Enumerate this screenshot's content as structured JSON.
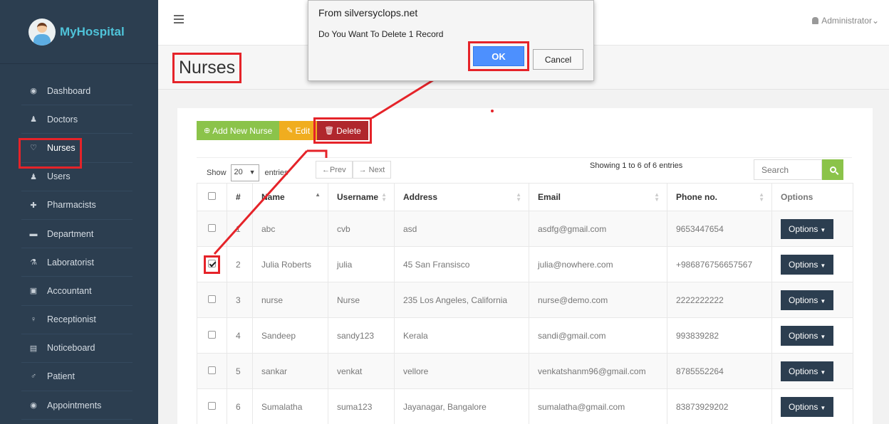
{
  "brand": {
    "name": "MyHospital"
  },
  "sidebar": {
    "items": [
      {
        "label": "Dashboard",
        "icon": "dashboard-icon",
        "glyph": "◉"
      },
      {
        "label": "Doctors",
        "icon": "user-md-icon",
        "glyph": "♟"
      },
      {
        "label": "Nurses",
        "icon": "stethoscope-icon",
        "glyph": "♡"
      },
      {
        "label": "Users",
        "icon": "user-icon",
        "glyph": "♟"
      },
      {
        "label": "Pharmacists",
        "icon": "plus-square-icon",
        "glyph": "✚"
      },
      {
        "label": "Department",
        "icon": "briefcase-icon",
        "glyph": "▬"
      },
      {
        "label": "Laboratorist",
        "icon": "flask-icon",
        "glyph": "⚗"
      },
      {
        "label": "Accountant",
        "icon": "money-icon",
        "glyph": "▣"
      },
      {
        "label": "Receptionist",
        "icon": "female-icon",
        "glyph": "♀"
      },
      {
        "label": "Noticeboard",
        "icon": "file-icon",
        "glyph": "▤"
      },
      {
        "label": "Patient",
        "icon": "male-icon",
        "glyph": "♂"
      },
      {
        "label": "Appointments",
        "icon": "dashboard-icon",
        "glyph": "◉"
      }
    ]
  },
  "header": {
    "user": "Administrator",
    "caret": "⌄"
  },
  "page": {
    "title": "Nurses"
  },
  "toolbar": {
    "add_label": "Add New Nurse",
    "edit_label": "Edit",
    "delete_label": "Delete"
  },
  "controls": {
    "show_label": "Show",
    "entries_value": "20",
    "entries_label": "entries",
    "prev_label": "←Prev",
    "next_label": "→ Next",
    "showing_text": "Showing 1 to 6 of 6 entries",
    "search_placeholder": "Search"
  },
  "table": {
    "headers": [
      "#",
      "Name",
      "Username",
      "Address",
      "Email",
      "Phone no.",
      "Options"
    ],
    "rows": [
      {
        "num": "1",
        "name": "abc",
        "username": "cvb",
        "address": "asd",
        "email": "asdfg@gmail.com",
        "phone": "9653447654",
        "checked": false
      },
      {
        "num": "2",
        "name": "Julia Roberts",
        "username": "julia",
        "address": "45 San Fransisco",
        "email": "julia@nowhere.com",
        "phone": "+986876756657567",
        "checked": true
      },
      {
        "num": "3",
        "name": "nurse",
        "username": "Nurse",
        "address": "235 Los Angeles, California",
        "email": "nurse@demo.com",
        "phone": "2222222222",
        "checked": false
      },
      {
        "num": "4",
        "name": "Sandeep",
        "username": "sandy123",
        "address": "Kerala",
        "email": "sandi@gmail.com",
        "phone": "993839282",
        "checked": false
      },
      {
        "num": "5",
        "name": "sankar",
        "username": "venkat",
        "address": "vellore",
        "email": "venkatshanm96@gmail.com",
        "phone": "8785552264",
        "checked": false
      },
      {
        "num": "6",
        "name": "Sumalatha",
        "username": "suma123",
        "address": "Jayanagar, Bangalore",
        "email": "sumalatha@gmail.com",
        "phone": "83873929202",
        "checked": false
      }
    ],
    "options_label": "Options"
  },
  "dialog": {
    "title": "From silversyclops.net",
    "message": "Do You Want To Delete 1 Record",
    "ok_label": "OK",
    "cancel_label": "Cancel"
  },
  "colors": {
    "sidebar_bg": "#2c3e50",
    "accent_green": "#8bc34a",
    "edit_yellow": "#f0ad1f",
    "delete_red": "#b0272d",
    "annotation_red": "#e52329",
    "ok_blue": "#4d90fe"
  }
}
